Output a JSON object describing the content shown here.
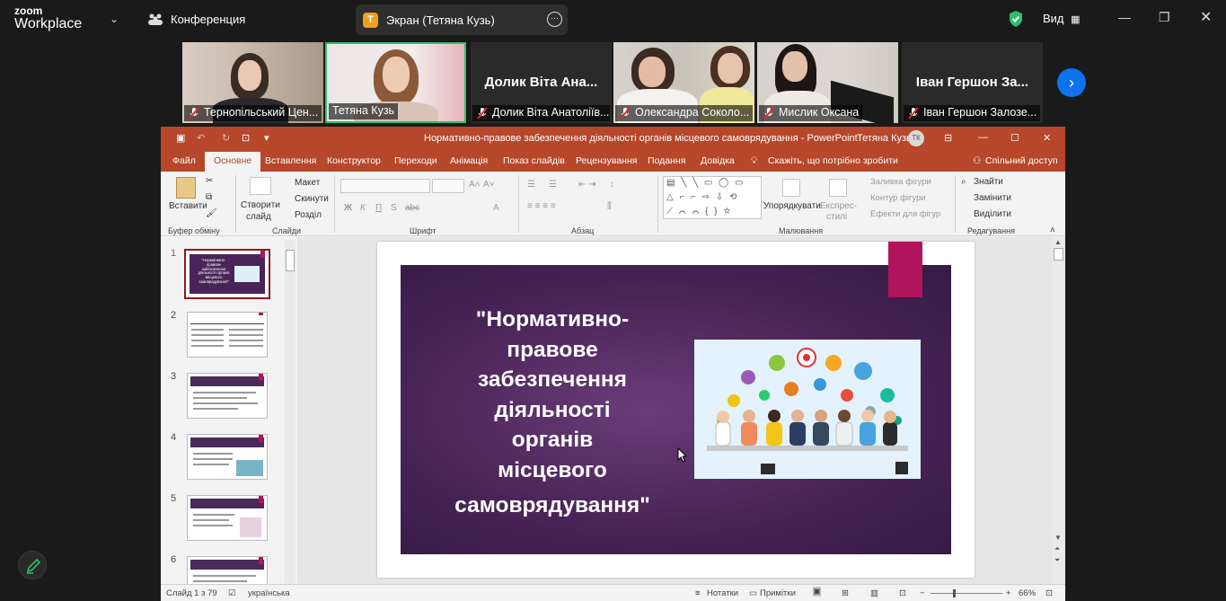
{
  "zoom": {
    "logo_top": "zoom",
    "logo_bottom": "Workplace",
    "conference_label": "Конференция",
    "share_badge": "T",
    "share_label": "Экран (Тетяна Кузь)",
    "view_label": "Вид",
    "colors": {
      "accent": "#0e72ed",
      "active_speaker": "#2dbf6c",
      "shield": "#2dbf6c"
    }
  },
  "participants": [
    {
      "label": "Тернопільський Цен...",
      "big_name": "",
      "muted": true,
      "video": true
    },
    {
      "label": "Тетяна Кузь",
      "big_name": "",
      "muted": false,
      "video": true,
      "active": true
    },
    {
      "label": "Долик Віта Анатоліїв...",
      "big_name": "Долик Віта Ана...",
      "muted": true,
      "video": false
    },
    {
      "label": "Олександра Соколо...",
      "big_name": "",
      "muted": true,
      "video": true
    },
    {
      "label": "Мислик Оксана",
      "big_name": "",
      "muted": true,
      "video": true
    },
    {
      "label": "Іван Гершон Залозе...",
      "big_name": "Іван Гершон За...",
      "muted": true,
      "video": false
    }
  ],
  "ppt": {
    "title": "Нормативно-правове забезпечення діяльності органів місцевого самоврядування  -  PowerPoint",
    "user_name": "Тетяна Кузь",
    "user_initials": "ТК",
    "tabs": [
      "Файл",
      "Основне",
      "Вставлення",
      "Конструктор",
      "Переходи",
      "Анімація",
      "Показ слайдів",
      "Рецензування",
      "Подання",
      "Довідка"
    ],
    "tell_me": "Скажіть, що потрібно зробити",
    "share": "Спільний доступ",
    "ribbon": {
      "paste": "Вставити",
      "new_slide_1": "Створити",
      "new_slide_2": "слайд",
      "layout": "Макет",
      "reset": "Скинути",
      "sections": "Розділ",
      "bold": "Ж",
      "italic": "К",
      "underline": "П",
      "strike": "S",
      "spacing": "abc",
      "arrange": "Упорядкувати",
      "quick_styles_1": "Експрес-",
      "quick_styles_2": "стилі",
      "shape_fill": "Заливка фігури",
      "shape_outline": "Контур фігури",
      "shape_effects": "Ефекти для фігур",
      "find": "Знайти",
      "replace": "Замінити",
      "select": "Виділити",
      "groups": [
        "Буфер обміну",
        "Слайди",
        "Шрифт",
        "Абзац",
        "Малювання",
        "Редагування"
      ]
    },
    "slide_numbers": [
      "1",
      "2",
      "3",
      "4",
      "5",
      "6"
    ],
    "thumb1_text": "\"Нормативно-правове забезпечення діяльності органів місцевого самоврядування\"",
    "slide_title_lines": [
      "\"Нормативно-",
      "правове",
      "забезпечення",
      "діяльності",
      "органів",
      "місцевого",
      "самоврядування\""
    ],
    "status": {
      "slide_of": "Слайд 1 з 79",
      "language": "українська",
      "notes": "Нотатки",
      "comments": "Примітки",
      "zoom": "66%"
    },
    "colors": {
      "accent": "#b7472a",
      "slide_purple": "#4a2458",
      "slide_magenta": "#b0145c"
    }
  }
}
